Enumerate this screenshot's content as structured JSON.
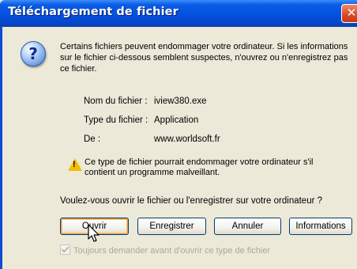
{
  "window": {
    "title": "Téléchargement de fichier",
    "close_glyph": "✕"
  },
  "warning": {
    "icon": "question-icon",
    "text": "Certains fichiers peuvent endommager votre ordinateur. Si les informations sur le fichier ci-dessous semblent suspectes, n'ouvrez ou n'enregistrez pas ce fichier."
  },
  "file_info": {
    "name_label": "Nom du fichier :",
    "name_value": "iview380.exe",
    "type_label": "Type du fichier :",
    "type_value": "Application",
    "from_label": "De :",
    "from_value": "www.worldsoft.fr"
  },
  "alert": {
    "icon": "warning-triangle-icon",
    "text": "Ce type de fichier pourrait endommager votre ordinateur s'il contient un programme malveillant."
  },
  "question": "Voulez-vous ouvrir le fichier ou l'enregistrer sur votre ordinateur ?",
  "buttons": {
    "open": "Ouvrir",
    "save": "Enregistrer",
    "cancel": "Annuler",
    "info": "Informations"
  },
  "checkbox": {
    "label": "Toujours demander avant d'ouvrir ce type de fichier",
    "checked": true,
    "enabled": false
  },
  "colors": {
    "titlebar": "#0551df",
    "dialog_bg": "#ece9d8",
    "close_button": "#d84a25"
  }
}
